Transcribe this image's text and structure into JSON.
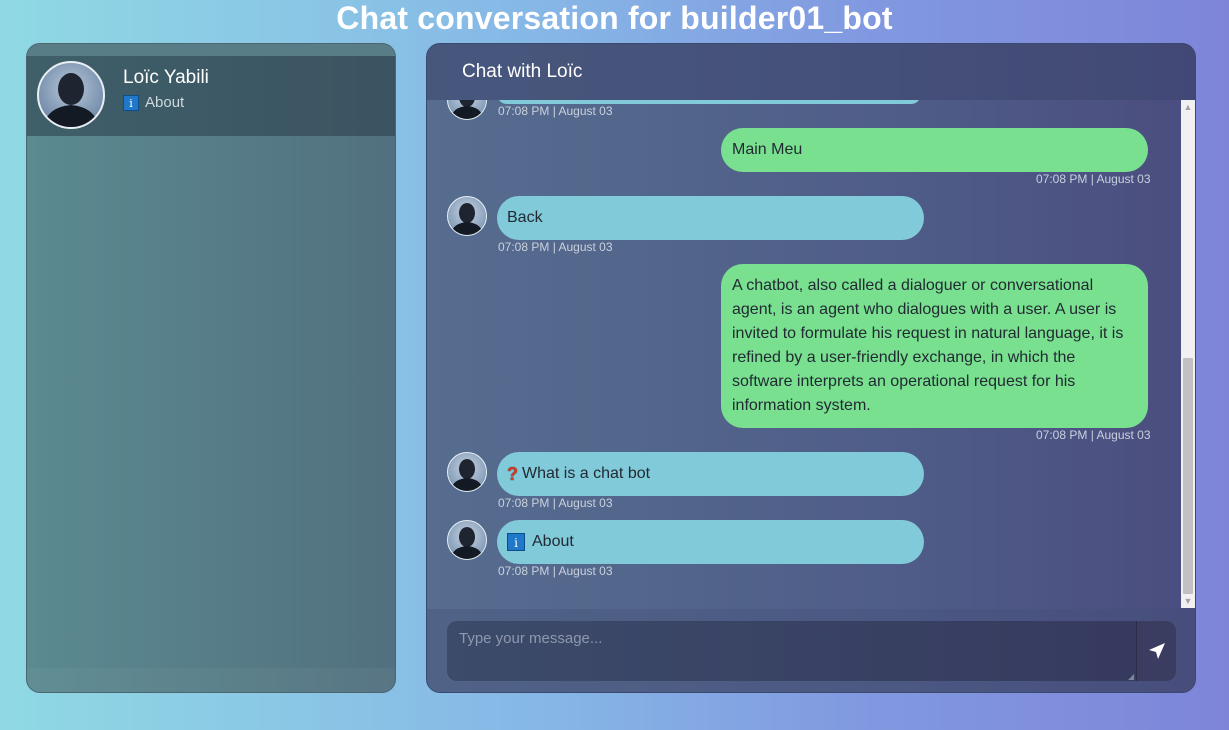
{
  "page": {
    "title": "Chat conversation for builder01_bot"
  },
  "contacts": [
    {
      "name": "Loïc Yabili",
      "status_icon": "info-icon",
      "status_text": "About"
    }
  ],
  "chat": {
    "header_title": "Chat with Loïc",
    "messages": [
      {
        "from": "bot",
        "text": "",
        "time": "07:08 PM | August 03"
      },
      {
        "from": "user",
        "text": "Main Meu",
        "time": "07:08 PM | August 03"
      },
      {
        "from": "bot",
        "text": "Back",
        "time": "07:08 PM | August 03"
      },
      {
        "from": "user",
        "text": "A chatbot, also called a dialoguer or conversational agent, is an agent who dialogues with a user. A user is invited to formulate his request in natural language, it is refined by a user-friendly exchange, in which the software interprets an operational request for his information system.",
        "time": "07:08 PM | August 03"
      },
      {
        "from": "bot",
        "icon": "question-mark-icon",
        "icon_glyph": "❓",
        "text": "What is a chat bot",
        "time": "07:08 PM | August 03"
      },
      {
        "from": "bot",
        "icon": "info-icon",
        "icon_glyph": "i",
        "text": "About",
        "time": "07:08 PM | August 03"
      }
    ],
    "input": {
      "placeholder": "Type your message...",
      "value": ""
    },
    "send_icon": "send-paper-plane-icon"
  },
  "colors": {
    "bot_bubble": "#80cad9",
    "user_bubble": "#78e08f",
    "title_text": "#ffffff"
  }
}
